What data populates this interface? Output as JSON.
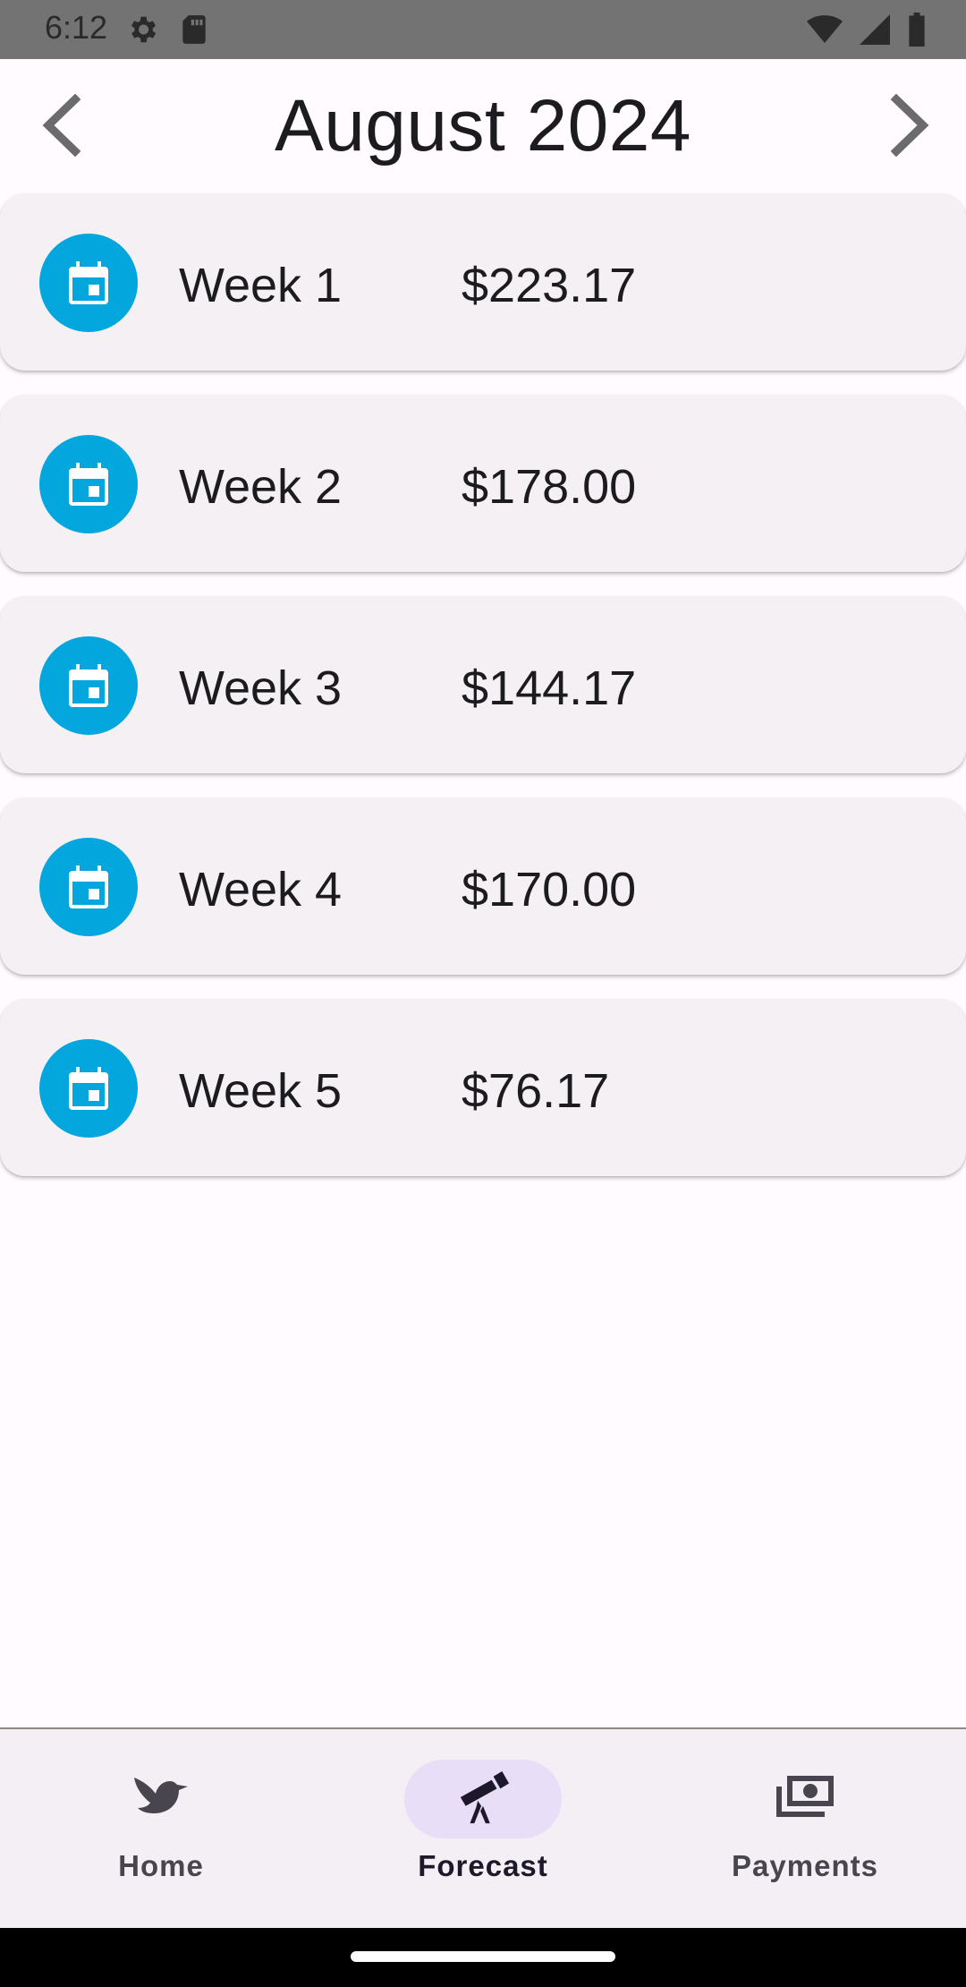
{
  "status_bar": {
    "time": "6:12",
    "left_icons": [
      "gear-icon",
      "sd-card-icon"
    ],
    "right_icons": [
      "wifi-icon",
      "signal-icon",
      "battery-icon"
    ]
  },
  "header": {
    "title": "August 2024",
    "prev_icon": "chevron-left-icon",
    "next_icon": "chevron-right-icon"
  },
  "weeks": [
    {
      "label": "Week 1",
      "amount": "$223.17",
      "icon": "calendar-icon"
    },
    {
      "label": "Week 2",
      "amount": "$178.00",
      "icon": "calendar-icon"
    },
    {
      "label": "Week 3",
      "amount": "$144.17",
      "icon": "calendar-icon"
    },
    {
      "label": "Week 4",
      "amount": "$170.00",
      "icon": "calendar-icon"
    },
    {
      "label": "Week 5",
      "amount": "$76.17",
      "icon": "calendar-icon"
    }
  ],
  "bottom_nav": {
    "items": [
      {
        "label": "Home",
        "icon": "bird-icon",
        "active": false
      },
      {
        "label": "Forecast",
        "icon": "telescope-icon",
        "active": true
      },
      {
        "label": "Payments",
        "icon": "money-icon",
        "active": false
      }
    ]
  },
  "colors": {
    "accent": "#03a6dd",
    "card_background": "#f4f0f4",
    "active_indicator": "#e8def8",
    "page_background": "#fffbfe"
  }
}
